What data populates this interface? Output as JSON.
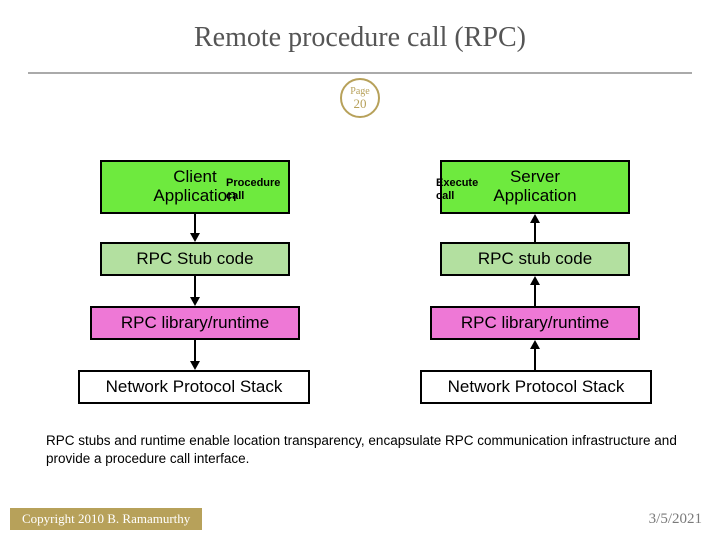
{
  "title": "Remote procedure call (RPC)",
  "page_badge": {
    "line1": "Page",
    "line2": "20"
  },
  "labels": {
    "procedure_call": "Procedure\ncall",
    "execute_call": "Execute\ncall"
  },
  "client": {
    "app": "Client\nApplication",
    "stub": "RPC Stub code",
    "runtime": "RPC library/runtime",
    "net": "Network Protocol Stack"
  },
  "server": {
    "app": "Server\nApplication",
    "stub": "RPC stub code",
    "runtime": "RPC library/runtime",
    "net": "Network Protocol Stack"
  },
  "caption": "RPC stubs and runtime enable location transparency, encapsulate RPC communication infrastructure and provide a procedure call interface.",
  "footer": {
    "copyright": "Copyright 2010 B. Ramamurthy",
    "date": "3/5/2021"
  },
  "colors": {
    "app": "#6eea3e",
    "stub": "#b3e0a0",
    "runtime": "#ee78d6",
    "accent": "#b7a15a"
  }
}
